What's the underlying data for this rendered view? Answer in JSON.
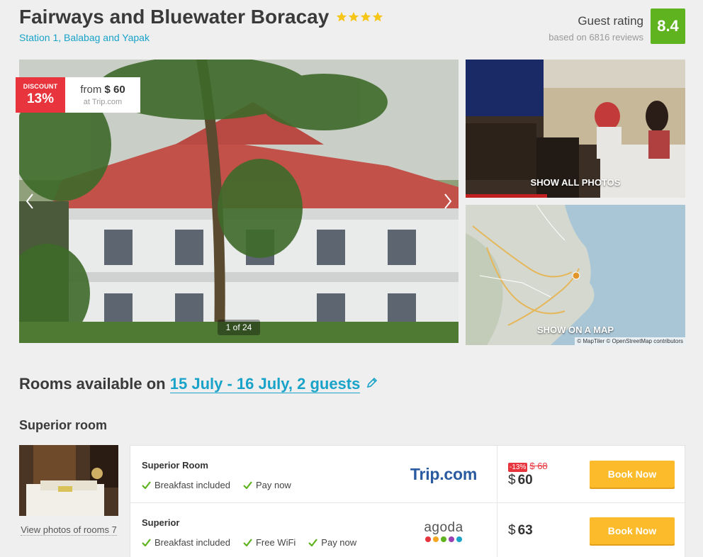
{
  "hotel": {
    "name": "Fairways and Bluewater Boracay",
    "stars": 4,
    "address": "Station 1, Balabag and Yapak"
  },
  "rating": {
    "label": "Guest rating",
    "reviews": "based on 6816 reviews",
    "score": "8.4",
    "color": "#5eb31f"
  },
  "gallery": {
    "discount_label": "DISCOUNT",
    "discount_value": "13%",
    "from_text": "from",
    "from_price": "$ 60",
    "price_source": "at Trip.com",
    "counter": "1 of 24",
    "show_all_photos": "SHOW ALL PHOTOS",
    "show_on_map": "SHOW ON A MAP",
    "map_credit": "© MapTiler © OpenStreetMap contributors"
  },
  "rooms_available": {
    "prefix": "Rooms available on",
    "dates": "15 July - 16 July, 2 guests"
  },
  "room_type": {
    "title": "Superior room",
    "photos_link": "View photos of rooms 7"
  },
  "offers": [
    {
      "name": "Superior Room",
      "amenities": [
        "Breakfast included",
        "Pay now"
      ],
      "provider": "Trip.com",
      "discount_tag": "-13%",
      "old_price": "$ 68",
      "currency": "$",
      "price": "60",
      "button": "Book Now"
    },
    {
      "name": "Superior",
      "amenities": [
        "Breakfast included",
        "Free WiFi",
        "Pay now"
      ],
      "provider": "agoda",
      "currency": "$",
      "price": "63",
      "button": "Book Now"
    }
  ],
  "colors": {
    "accent": "#1aa3c9",
    "discount": "#e8343c",
    "book_button": "#fbbb2b",
    "check": "#5eb31f"
  }
}
